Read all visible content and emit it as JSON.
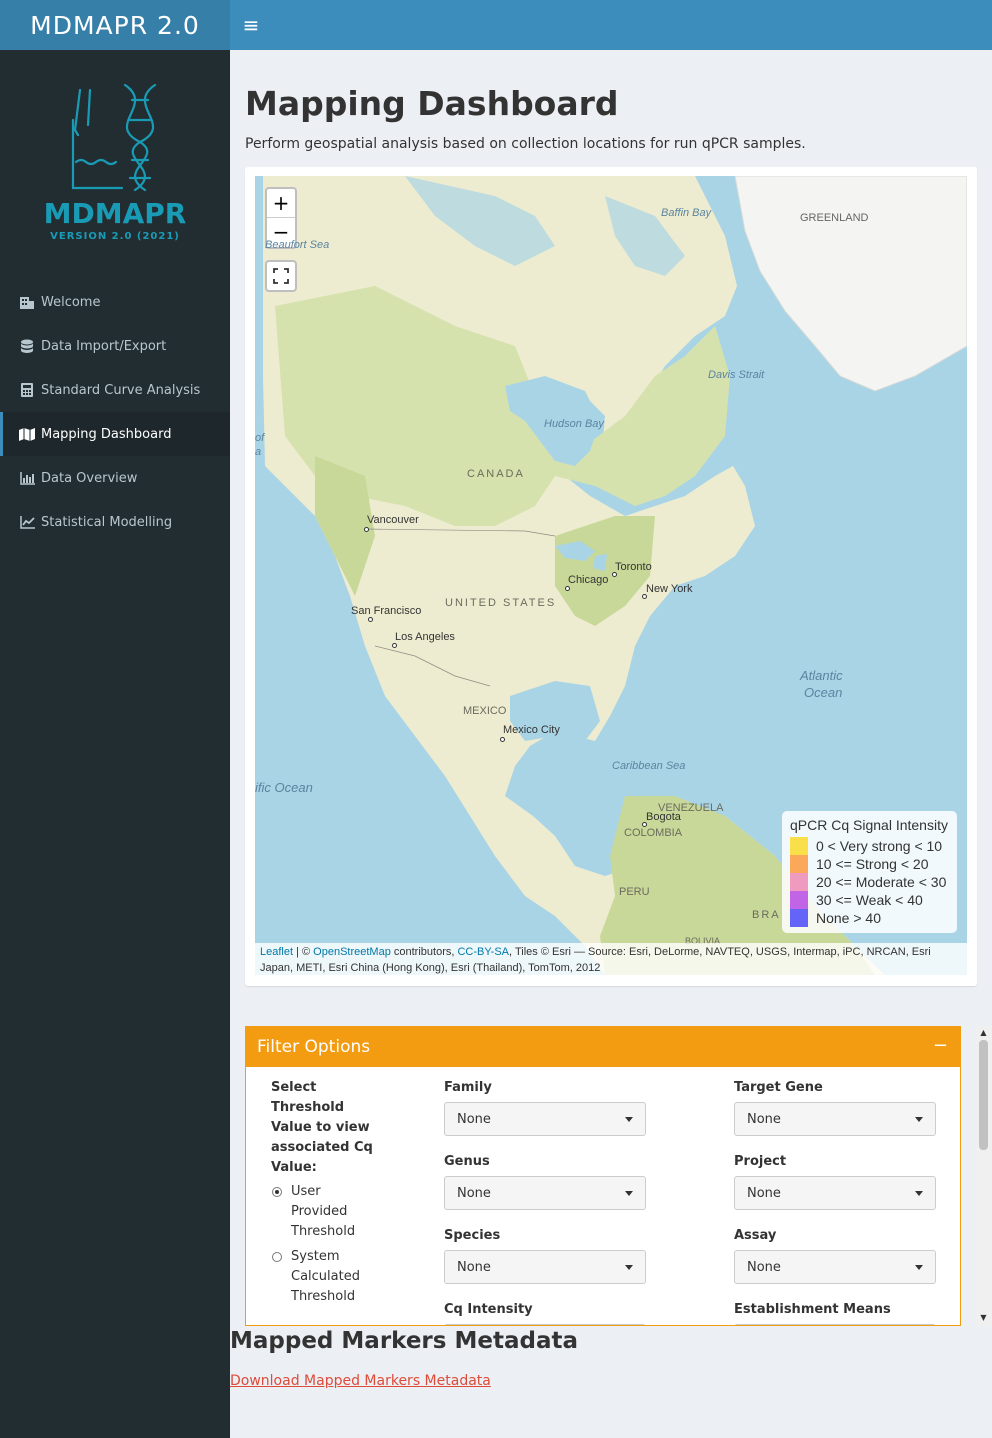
{
  "app": {
    "title": "MDMAPR 2.0"
  },
  "brand": {
    "name": "MDMAPR",
    "version": "VERSION 2.0 (2021)"
  },
  "nav": {
    "items": [
      {
        "label": "Welcome",
        "icon": "building-icon"
      },
      {
        "label": "Data Import/Export",
        "icon": "database-icon"
      },
      {
        "label": "Standard Curve Analysis",
        "icon": "calculator-icon"
      },
      {
        "label": "Mapping Dashboard",
        "icon": "map-icon",
        "active": true
      },
      {
        "label": "Data Overview",
        "icon": "bar-chart-icon"
      },
      {
        "label": "Statistical Modelling",
        "icon": "line-chart-icon"
      }
    ]
  },
  "page": {
    "title": "Mapping Dashboard",
    "subtitle": "Perform geospatial analysis based on collection locations for run qPCR samples."
  },
  "map": {
    "zoom_in": "+",
    "zoom_out": "−",
    "labels": {
      "baffin_bay": "Baffin Bay",
      "greenland": "GREENLAND",
      "beaufort_sea": "Beaufort Sea",
      "davis_strait": "Davis Strait",
      "hudson_bay": "Hudson Bay",
      "canada": "CANADA",
      "vancouver": "Vancouver",
      "toronto": "Toronto",
      "chicago": "Chicago",
      "new_york": "New York",
      "san_francisco": "San Francisco",
      "united_states": "UNITED STATES",
      "los_angeles": "Los Angeles",
      "atlantic": "Atlantic",
      "ocean": "Ocean",
      "mexico": "MEXICO",
      "mexico_city": "Mexico City",
      "caribbean": "Caribbean Sea",
      "pacific": "ific Ocean",
      "venezuela": "VENEZUELA",
      "bogota": "Bogota",
      "colombia": "COLOMBIA",
      "peru": "PERU",
      "brazil": "BRA",
      "bolivia": "BOLIVIA",
      "of_edge": "of",
      "a_edge": "a"
    },
    "legend": {
      "title": "qPCR Cq Signal Intensity",
      "items": [
        {
          "label": "0 < Very strong < 10",
          "color": "#f9e04a"
        },
        {
          "label": "10 <= Strong < 20",
          "color": "#fba85a"
        },
        {
          "label": "20 <= Moderate < 30",
          "color": "#ef9abf"
        },
        {
          "label": "30 <= Weak < 40",
          "color": "#c165e6"
        },
        {
          "label": "None > 40",
          "color": "#6464f8"
        }
      ]
    },
    "attribution": {
      "leaflet": "Leaflet",
      "sep1": " | © ",
      "osm": "OpenStreetMap",
      "text1": " contributors, ",
      "ccbysa": "CC-BY-SA",
      "text2": ", Tiles © Esri — Source: Esri, DeLorme, NAVTEQ, USGS, Intermap, iPC, NRCAN, Esri Japan, METI, Esri China (Hong Kong), Esri (Thailand), TomTom, 2012"
    }
  },
  "filter": {
    "title": "Filter Options",
    "collapse": "−",
    "threshold_label": "Select Threshold Value to view associated Cq Value:",
    "threshold_options": [
      "User Provided Threshold",
      "System Calculated Threshold"
    ],
    "threshold_selected": "User Provided Threshold",
    "family": {
      "label": "Family",
      "value": "None"
    },
    "genus": {
      "label": "Genus",
      "value": "None"
    },
    "species": {
      "label": "Species",
      "value": "None"
    },
    "cq_intensity": {
      "label": "Cq Intensity"
    },
    "target_gene": {
      "label": "Target Gene",
      "value": "None"
    },
    "project": {
      "label": "Project",
      "value": "None"
    },
    "assay": {
      "label": "Assay",
      "value": "None"
    },
    "establishment": {
      "label": "Establishment Means"
    }
  },
  "metadata": {
    "title": "Mapped Markers Metadata",
    "download_link": "Download Mapped Markers Metadata"
  },
  "colors": {
    "header": "#3c8dbc",
    "header_dark": "#367fa9",
    "sidebar": "#222d32",
    "accent": "#f39c12",
    "brand": "#1a9bb5",
    "link": "#dd4b39"
  }
}
